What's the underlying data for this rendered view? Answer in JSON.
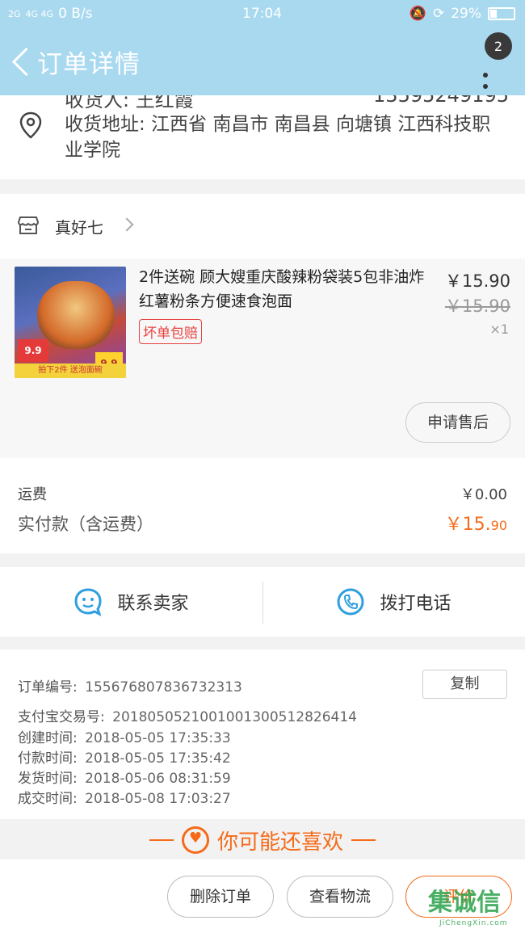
{
  "status_bar": {
    "signal1": "2G",
    "signal2": "4G 4G",
    "speed": "0 B/s",
    "time": "17:04",
    "battery": "29%"
  },
  "header": {
    "title": "订单详情",
    "badge_count": "2"
  },
  "address": {
    "receiver_peek": "收货人: 王红霞",
    "phone_peek": "13595249195",
    "full": "收货地址: 江西省 南昌市 南昌县 向塘镇 江西科技职业学院"
  },
  "shop": {
    "name": "真好七"
  },
  "product": {
    "title": "2件送碗 顾大嫂重庆酸辣粉袋装5包非油炸红薯粉条方便速食泡面",
    "guarantee": "坏单包赔",
    "price": "￥15.90",
    "original_price": "￥15.90",
    "quantity": "×1",
    "thumb_price1": "9.9",
    "thumb_price2": "9.9",
    "thumb_strip": "拍下2件 送泡面碗",
    "aftersale_label": "申请售后"
  },
  "fees": {
    "shipping_label": "运费",
    "shipping_value": "￥0.00",
    "paid_label": "实付款（含运费）",
    "paid_main": "￥15.",
    "paid_cents": "90"
  },
  "contact": {
    "seller_label": "联系卖家",
    "call_label": "拨打电话"
  },
  "order_info": {
    "order_no_label": "订单编号:",
    "order_no": "155676807836732313",
    "copy_label": "复制",
    "alipay_label": "支付宝交易号:",
    "alipay_no": "2018050521001001300512826414",
    "created_label": "创建时间:",
    "created": "2018-05-05  17:35:33",
    "paid_label": "付款时间:",
    "paid": "2018-05-05  17:35:42",
    "shipped_label": "发货时间:",
    "shipped": "2018-05-06  08:31:59",
    "done_label": "成交时间:",
    "done": "2018-05-08  17:03:27"
  },
  "recommend": {
    "label": "你可能还喜欢"
  },
  "bottom_bar": {
    "delete_label": "删除订单",
    "logistics_label": "查看物流",
    "review_label": "评价"
  },
  "watermark": {
    "text": "集诚信",
    "sub": "JiChengXin.com"
  },
  "colors": {
    "header_bg": "#a9d9ef",
    "accent_orange": "#f56b1a",
    "icon_blue": "#2e9fe0",
    "guarantee_red": "#e64340"
  }
}
